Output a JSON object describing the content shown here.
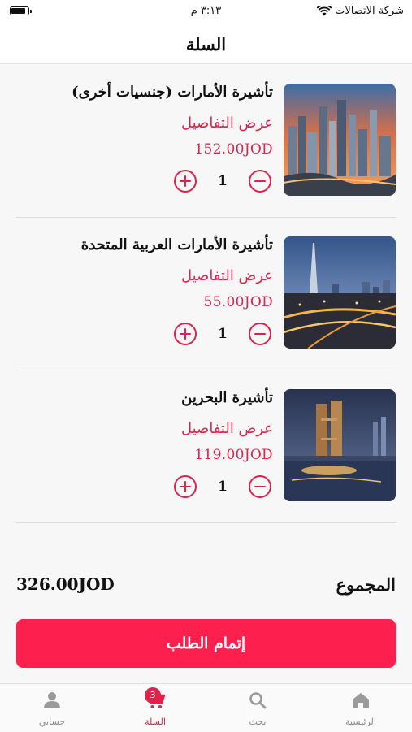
{
  "status_bar": {
    "carrier": "شركة الاتصالات",
    "time": "٣:١٣ م",
    "battery_level": 0.9
  },
  "header": {
    "title": "السلة"
  },
  "cart": {
    "items": [
      {
        "name": "تأشيرة الأمارات   (جنسيات أخرى)",
        "details_label": "عرض التفاصيل",
        "price": "152.00JOD",
        "quantity": "1",
        "image": "dubai-skyline-sunset"
      },
      {
        "name": "تأشيرة الأمارات العربية المتحدة",
        "details_label": "عرض التفاصيل",
        "price": "55.00JOD",
        "quantity": "1",
        "image": "dubai-burj-khalifa-night"
      },
      {
        "name": "تأشيرة البحرين",
        "details_label": "عرض التفاصيل",
        "price": "119.00JOD",
        "quantity": "1",
        "image": "bahrain-tower-night"
      }
    ]
  },
  "total": {
    "label": "المجموع",
    "value": "326.00JOD"
  },
  "checkout": {
    "label": "إتمام الطلب"
  },
  "tab_bar": {
    "tabs": [
      {
        "label": "الرئيسية",
        "icon": "home-icon",
        "active": false
      },
      {
        "label": "بحث",
        "icon": "search-icon",
        "active": false
      },
      {
        "label": "السلة",
        "icon": "cart-icon",
        "active": true,
        "badge": "3"
      },
      {
        "label": "حسابي",
        "icon": "person-icon",
        "active": false
      }
    ]
  },
  "colors": {
    "accent": "#e0224a",
    "button": "#fd1f4e",
    "background": "#f7f7f7"
  }
}
